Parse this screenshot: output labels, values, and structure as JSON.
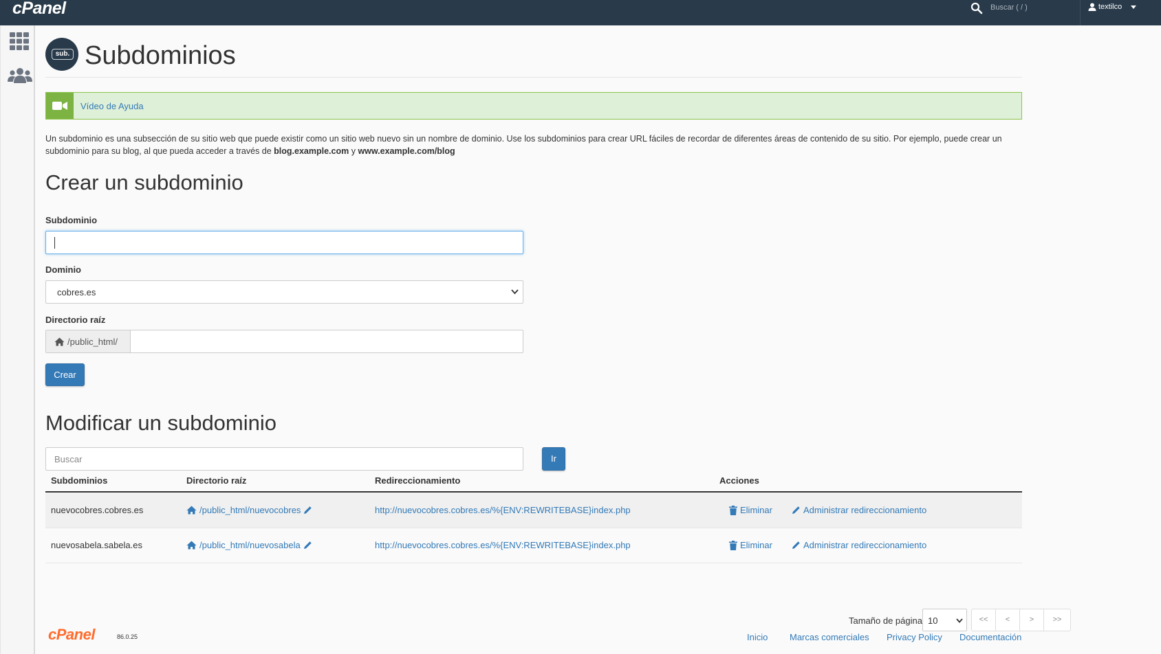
{
  "topbar": {
    "logo": "cPanel",
    "search_placeholder": "Buscar ( / )",
    "username": "textilco"
  },
  "sidebar": {
    "items": [
      {
        "icon": "apps-grid-icon"
      },
      {
        "icon": "users-icon"
      }
    ]
  },
  "page": {
    "icon_text": "sub.",
    "title": "Subdominios",
    "help_video": "Vídeo de Ayuda",
    "description_1": "Un subdominio es una subsección de su sitio web que puede existir como un sitio web nuevo sin un nombre de dominio. Use los subdominios para crear URL fáciles de recordar de diferentes áreas de contenido de su sitio. Por ejemplo, puede crear un subdominio para su blog, al que pueda acceder a través de ",
    "description_bold_1": "blog.example.com",
    "description_and": " y ",
    "description_bold_2": "www.example.com/blog"
  },
  "create": {
    "title": "Crear un subdominio",
    "subdomain_label": "Subdominio",
    "subdomain_value": "",
    "domain_label": "Dominio",
    "domain_selected": "cobres.es",
    "root_label": "Directorio raíz",
    "root_prefix": "/public_html/",
    "root_value": "",
    "create_button": "Crear"
  },
  "modify": {
    "title": "Modificar un subdominio",
    "search_placeholder": "Buscar",
    "go_button": "Ir",
    "columns": [
      "Subdominios",
      "Directorio raíz",
      "Redireccionamiento",
      "Acciones"
    ],
    "rows": [
      {
        "subdomain": "nuevocobres.cobres.es",
        "root": "/public_html/nuevocobres",
        "redirect": "http://nuevocobres.cobres.es/%{ENV:REWRITEBASE}index.php",
        "delete": "Eliminar",
        "manage": "Administrar redireccionamiento"
      },
      {
        "subdomain": "nuevosabela.sabela.es",
        "root": "/public_html/nuevosabela",
        "redirect": "http://nuevocobres.cobres.es/%{ENV:REWRITEBASE}index.php",
        "delete": "Eliminar",
        "manage": "Administrar redireccionamiento"
      }
    ],
    "page_size_label": "Tamaño de página",
    "page_size": "10",
    "pager": [
      "<<",
      "<",
      ">",
      ">>"
    ]
  },
  "footer": {
    "logo": "cPanel",
    "version": "86.0.25",
    "links": [
      "Inicio",
      "Marcas comerciales",
      "Privacy Policy",
      "Documentación"
    ]
  },
  "colors": {
    "topbar": "#293a4a",
    "link": "#337ab7",
    "primary": "#337ab7",
    "help_bg": "#dff0d8",
    "help_icon_bg": "#7cb342",
    "footer_logo": "#ff6c2c"
  }
}
